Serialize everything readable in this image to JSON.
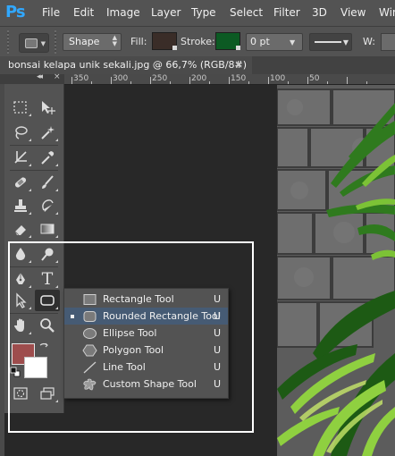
{
  "app": {
    "logo": "Ps"
  },
  "menu": [
    "File",
    "Edit",
    "Image",
    "Layer",
    "Type",
    "Select",
    "Filter",
    "3D",
    "View",
    "Win"
  ],
  "options_bar": {
    "mode": "Shape",
    "fill_label": "Fill:",
    "stroke_label": "Stroke:",
    "stroke_width": "0 pt",
    "w_label": "W:",
    "fill_color": "#3a2d28",
    "stroke_color": "#0c5a23"
  },
  "document": {
    "tab_title": "bonsai kelapa unik sekali.jpg @ 66,7% (RGB/8#)",
    "close_glyph": "×"
  },
  "ruler": {
    "marks": [
      "350",
      "300",
      "250",
      "200",
      "150",
      "100",
      "50"
    ]
  },
  "toolbox": {
    "header_collapse": "◂◂",
    "header_close": "×",
    "foreground_color": "#9e4d4d",
    "background_color": "#ffffff",
    "type_tool_glyph": "T"
  },
  "flyout": {
    "items": [
      {
        "label": "Rectangle Tool",
        "shortcut": "U",
        "icon": "rectangle-icon",
        "selected": false
      },
      {
        "label": "Rounded Rectangle Tool",
        "shortcut": "U",
        "icon": "rounded-rectangle-icon",
        "selected": true
      },
      {
        "label": "Ellipse Tool",
        "shortcut": "U",
        "icon": "ellipse-icon",
        "selected": false
      },
      {
        "label": "Polygon Tool",
        "shortcut": "U",
        "icon": "polygon-icon",
        "selected": false
      },
      {
        "label": "Line Tool",
        "shortcut": "U",
        "icon": "line-icon",
        "selected": false
      },
      {
        "label": "Custom Shape Tool",
        "shortcut": "U",
        "icon": "custom-shape-icon",
        "selected": false
      }
    ]
  },
  "colors": {
    "selection_highlight": "#465b74",
    "annotation_box": "#ffffff"
  }
}
